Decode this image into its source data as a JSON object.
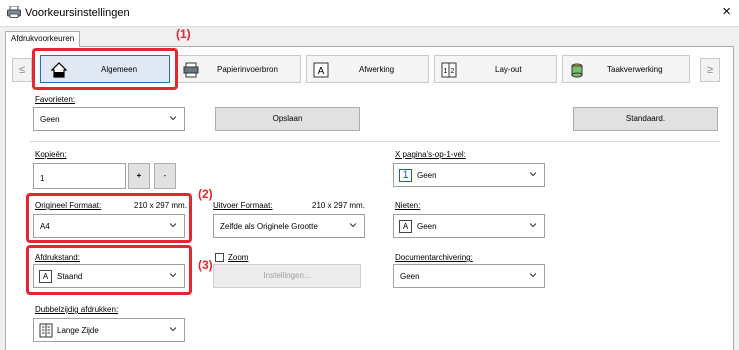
{
  "window": {
    "title": "Voorkeursinstellingen",
    "close": "×"
  },
  "tab": {
    "label": "Afdrukvoorkeuren"
  },
  "nav": {
    "prev": "≤",
    "next": "≥"
  },
  "categories": [
    {
      "label": "Algemeen",
      "icon": "home-icon"
    },
    {
      "label": "Papierinvoerbron",
      "icon": "printer-paper-icon"
    },
    {
      "label": "Afwerking",
      "icon": "finishing-icon"
    },
    {
      "label": "Lay-out",
      "icon": "layout-icon"
    },
    {
      "label": "Taakverwerking",
      "icon": "job-stack-icon"
    }
  ],
  "callouts": {
    "c1": "(1)",
    "c2": "(2)",
    "c3": "(3)"
  },
  "favorites": {
    "label": "Favorieten:",
    "value": "Geen",
    "save": "Opslaan",
    "default": "Standaard."
  },
  "copies": {
    "label": "Kopieën:",
    "value": "1",
    "plus": "+",
    "minus": "-"
  },
  "original_size": {
    "label": "Origineel Formaat:",
    "dims": "210 x 297 mm.",
    "value": "A4"
  },
  "output_size": {
    "label": "Uitvoer Formaat:",
    "dims": "210 x 297 mm.",
    "value": "Zelfde als Originele Grootte"
  },
  "orientation": {
    "label": "Afdrukstand:",
    "value": "Staand",
    "icon_letter": "A"
  },
  "zoom": {
    "label": "Zoom",
    "settings": "Instellingen..."
  },
  "duplex": {
    "label": "Dubbelzijdig afdrukken:",
    "value": "Lange Zijde"
  },
  "n_up": {
    "label": "X pagina's-op-1-vel:",
    "value": "Geen",
    "icon_digit": "1"
  },
  "staple": {
    "label": "Nieten:",
    "value": "Geen",
    "icon_letter": "A"
  },
  "doc_filing": {
    "label": "Documentarchivering:",
    "value": "Geen"
  }
}
